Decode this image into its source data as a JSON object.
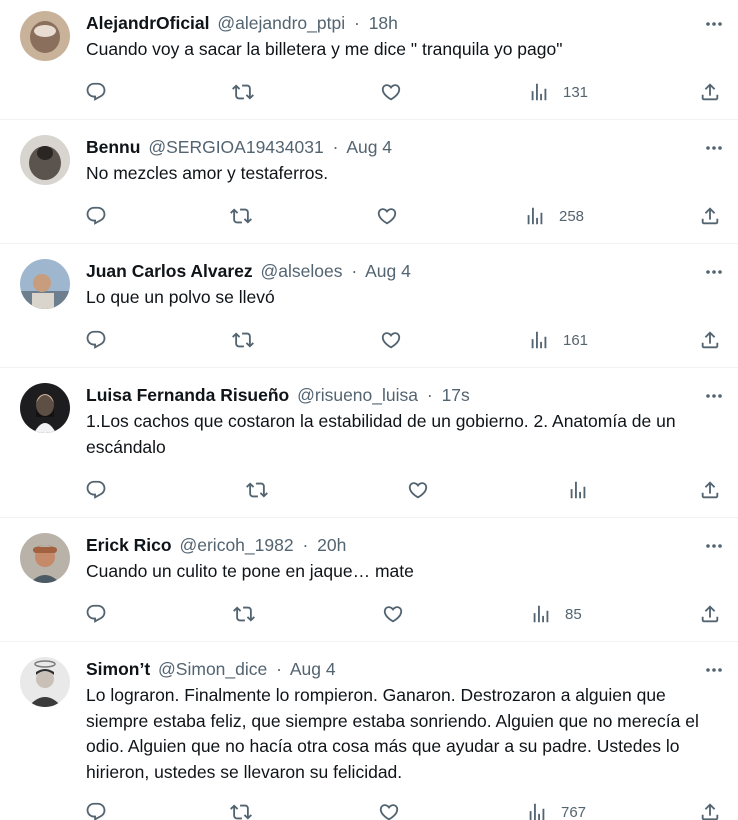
{
  "tweets": [
    {
      "name": "AlejandrOficial",
      "handle": "@alejandro_ptpi",
      "time": "18h",
      "text": "Cuando voy a sacar la billetera y me dice \" tranquila yo pago\"",
      "views": "131",
      "avatar_color": "#8a6f5c"
    },
    {
      "name": "Bennu",
      "handle": "@SERGIOA19434031",
      "time": "Aug 4",
      "text": "No mezcles amor y testaferros.",
      "views": "258",
      "avatar_color": "#5b534d"
    },
    {
      "name": "Juan Carlos Alvarez",
      "handle": "@alseloes",
      "time": "Aug 4",
      "text": "Lo que un polvo se llevó",
      "views": "161",
      "avatar_color": "#9fb6cf"
    },
    {
      "name": "Luisa Fernanda Risueño",
      "handle": "@risueno_luisa",
      "time": "17s",
      "text": "1.Los cachos que costaron la estabilidad de un gobierno. 2. Anatomía de un escándalo",
      "views": "",
      "avatar_color": "#1d1d1f"
    },
    {
      "name": "Erick Rico",
      "handle": "@ericoh_1982",
      "time": "20h",
      "text": "Cuando un culito te pone en jaque… mate",
      "views": "85",
      "avatar_color": "#a3623f"
    },
    {
      "name": "Simon’t",
      "handle": "@Simon_dice",
      "time": "Aug 4",
      "text": "Lo lograron. Finalmente lo rompieron. Ganaron. Destrozaron a alguien que siempre estaba feliz, que siempre estaba sonriendo. Alguien que no merecía el odio. Alguien que no hacía otra cosa más que ayudar a su padre. Ustedes lo hirieron, ustedes se llevaron su felicidad.",
      "views": "767",
      "avatar_color": "#3b3b3b"
    }
  ],
  "separator": "·",
  "icons": {
    "more": "more-horizontal-icon",
    "reply": "reply-icon",
    "retweet": "retweet-icon",
    "like": "like-icon",
    "views": "views-icon",
    "share": "share-icon"
  },
  "colors": {
    "text": "#0f1419",
    "secondary": "#536471",
    "divider": "#eff3f4"
  }
}
